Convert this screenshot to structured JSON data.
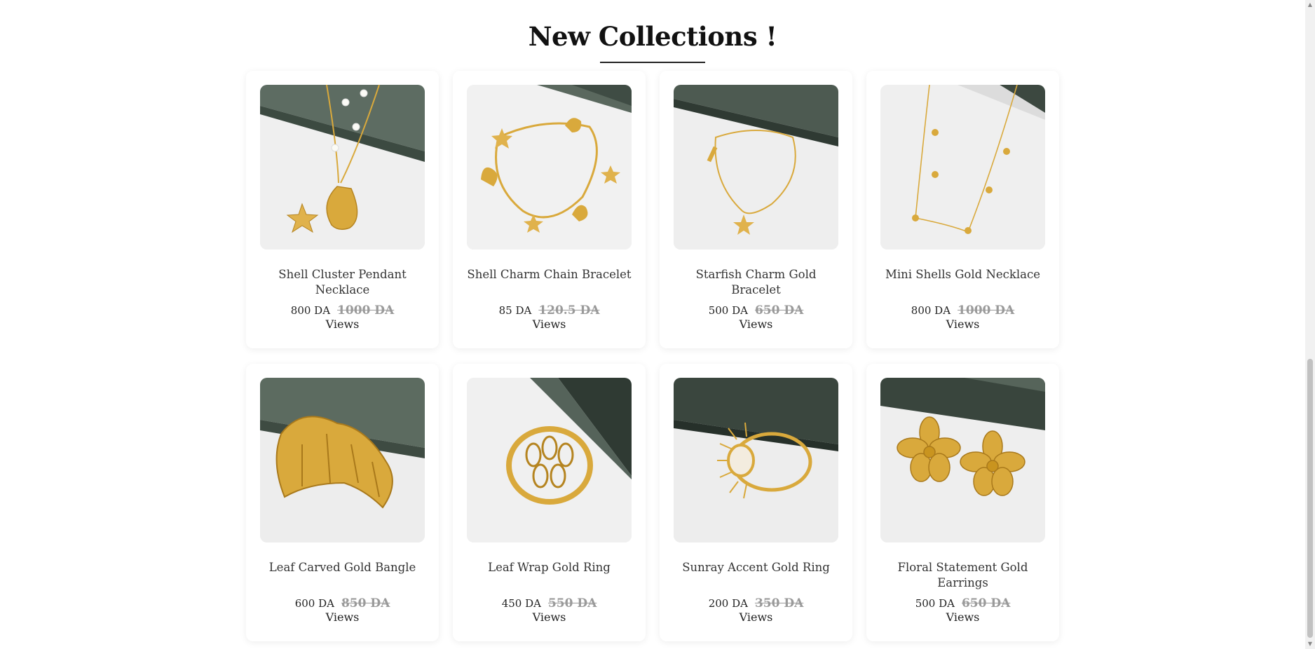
{
  "section": {
    "title": "New Collections !"
  },
  "products": [
    {
      "name": "Shell Cluster Pendant Necklace",
      "price": "800 DA",
      "old_price": "1000 DA",
      "views": "Views",
      "image_icon": "shell-necklace-icon"
    },
    {
      "name": "Shell Charm Chain Bracelet",
      "price": "85 DA",
      "old_price": "120.5 DA",
      "views": "Views",
      "image_icon": "shell-bracelet-icon"
    },
    {
      "name": "Starfish Charm Gold Bracelet",
      "price": "500 DA",
      "old_price": "650 DA",
      "views": "Views",
      "image_icon": "starfish-bracelet-icon"
    },
    {
      "name": "Mini Shells Gold Necklace",
      "price": "800 DA",
      "old_price": "1000 DA",
      "views": "Views",
      "image_icon": "mini-shells-necklace-icon"
    },
    {
      "name": "Leaf Carved Gold Bangle",
      "price": "600 DA",
      "old_price": "850 DA",
      "views": "Views",
      "image_icon": "leaf-bangle-icon"
    },
    {
      "name": "Leaf Wrap Gold Ring",
      "price": "450 DA",
      "old_price": "550 DA",
      "views": "Views",
      "image_icon": "leaf-ring-icon"
    },
    {
      "name": "Sunray Accent Gold Ring",
      "price": "200 DA",
      "old_price": "350 DA",
      "views": "Views",
      "image_icon": "sunray-ring-icon"
    },
    {
      "name": "Floral Statement Gold Earrings",
      "price": "500 DA",
      "old_price": "650 DA",
      "views": "Views",
      "image_icon": "floral-earrings-icon"
    }
  ],
  "colors": {
    "gold": "#d9a93c",
    "backdrop_green": "#4a5a4f",
    "old_price_gray": "#9a9a9a"
  }
}
